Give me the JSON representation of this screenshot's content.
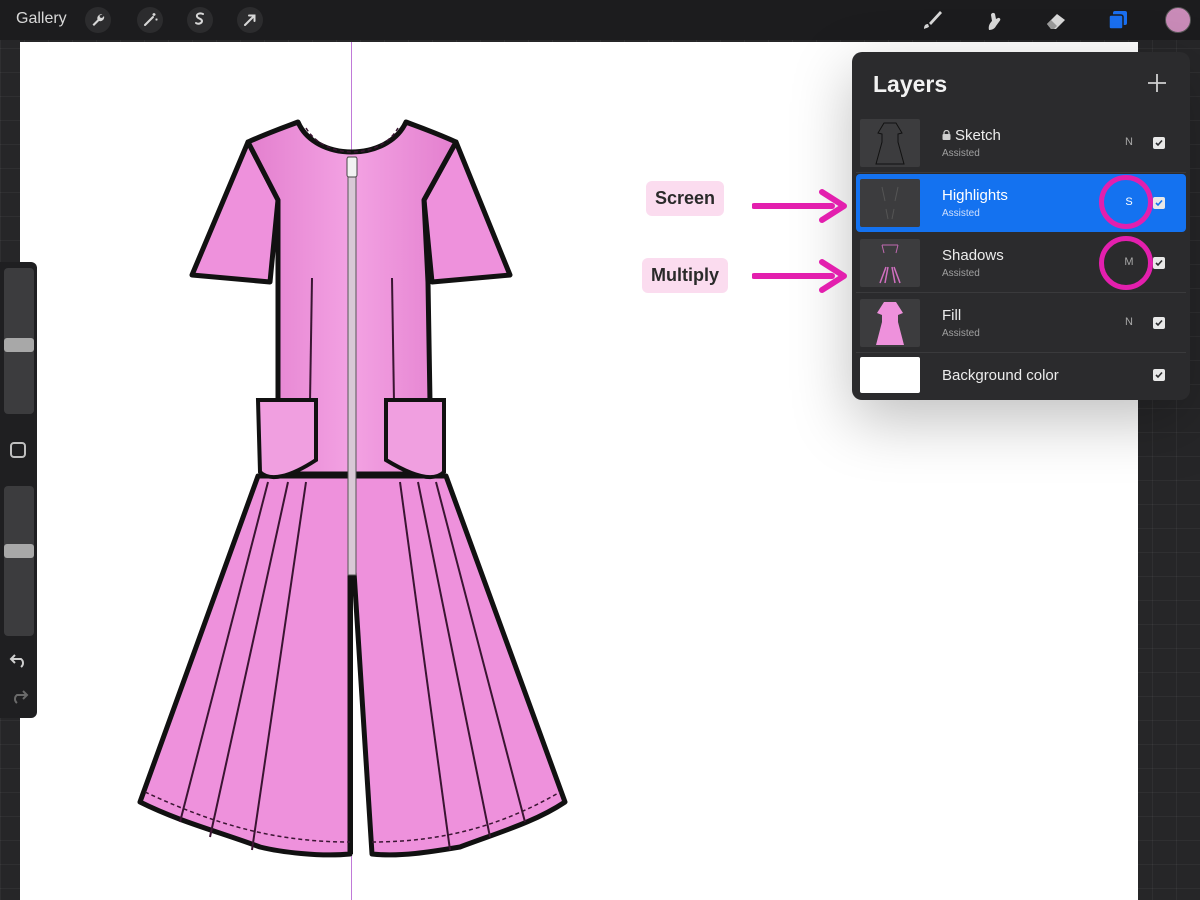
{
  "topbar": {
    "gallery_label": "Gallery",
    "left_tools": [
      "wrench-icon",
      "magic-wand-icon",
      "selection-icon",
      "transform-icon"
    ],
    "right_tools": [
      "brush-icon",
      "smudge-icon",
      "eraser-icon",
      "layers-icon"
    ],
    "current_color": "#c98bb8",
    "active_tool_color": "#1a6ff0"
  },
  "sidebar": {
    "tools": [
      "brush-size-slider",
      "modify-button",
      "opacity-slider",
      "undo-icon",
      "redo-icon"
    ]
  },
  "layers_panel": {
    "title": "Layers",
    "add_icon": "plus-icon",
    "layers": [
      {
        "name": "Sketch",
        "sub": "Assisted",
        "blend": "N",
        "locked": true,
        "visible": true
      },
      {
        "name": "Highlights",
        "sub": "Assisted",
        "blend": "S",
        "selected": true,
        "visible": true
      },
      {
        "name": "Shadows",
        "sub": "Assisted",
        "blend": "M",
        "visible": true
      },
      {
        "name": "Fill",
        "sub": "Assisted",
        "blend": "N",
        "visible": true
      },
      {
        "name": "Background color",
        "visible": true
      }
    ]
  },
  "annotations": {
    "screen_label": "Screen",
    "multiply_label": "Multiply",
    "accent_color": "#e31fae",
    "label_bg": "#fbdcef"
  },
  "canvas": {
    "dress_color": "#ec8ed7",
    "symmetry_line_color": "#c07ad8"
  }
}
